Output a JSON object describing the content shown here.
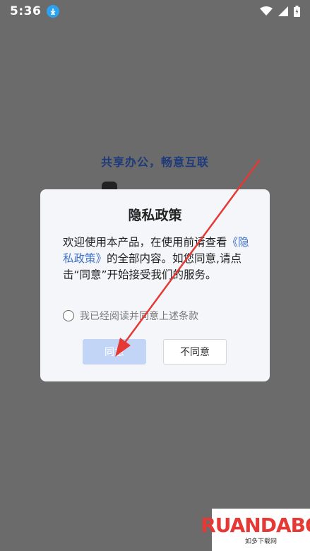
{
  "status_bar": {
    "time": "5:36",
    "icons": [
      "download-icon",
      "wifi-icon",
      "signal-icon",
      "battery-icon"
    ]
  },
  "background": {
    "slogan": "共享办公，畅意互联"
  },
  "dialog": {
    "title": "隐私政策",
    "body_prefix": "欢迎使用本产品，在使用前请查看",
    "policy_link": "《隐私政策》",
    "body_suffix": "的全部内容。如您同意,请点击“同意”开始接受我们的服务。",
    "agree_label": "我已经阅读并同意上述条款",
    "agree_checked": false,
    "agree_button": "同意",
    "disagree_button": "不同意"
  },
  "watermark": {
    "logo": "RUANDABO",
    "sub": "如多下载网"
  },
  "colors": {
    "overlay": "#6b6b6b",
    "agree_button_bg": "#c3d5f6",
    "link": "#3f6fc9",
    "arrow": "#e53935"
  }
}
